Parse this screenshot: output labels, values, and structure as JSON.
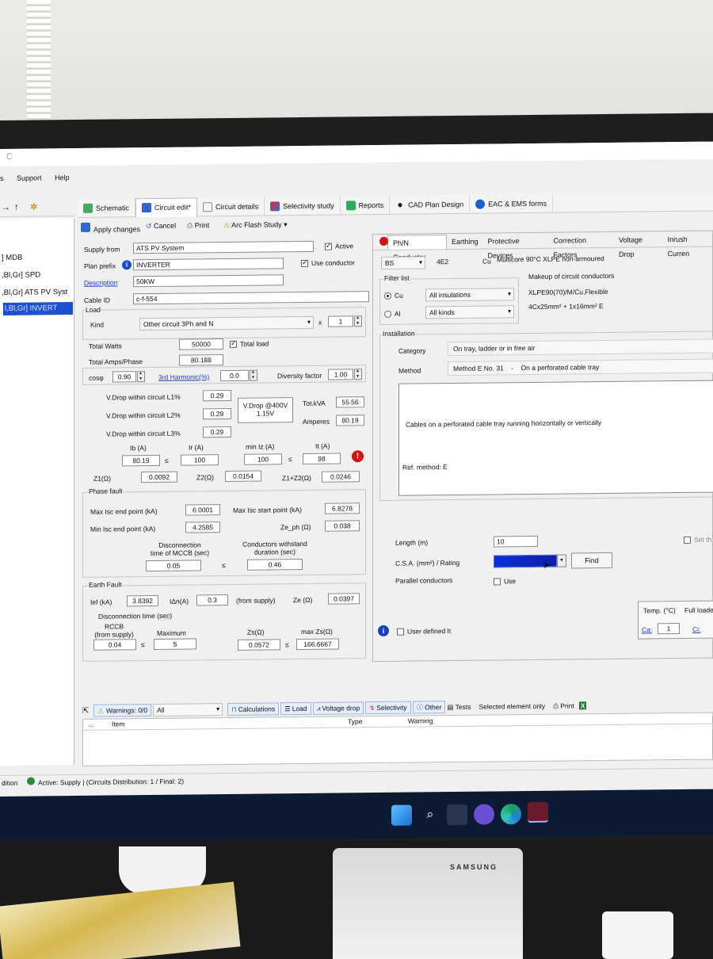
{
  "monitor": {
    "brand": "SAMSUNG"
  },
  "menu": [
    "s",
    "Support",
    "Help"
  ],
  "tabs": [
    "Schematic",
    "Circuit edit*",
    "Circuit details",
    "Selectivity study",
    "Reports",
    "CAD Plan Design",
    "EAC & EMS forms"
  ],
  "toolbar": {
    "apply": "Apply changes",
    "cancel": "Cancel",
    "print": "Print",
    "arc": "Arc Flash Study"
  },
  "tree": [
    {
      "label": "] MDB"
    },
    {
      "label": ",Bl,Gr] SPD"
    },
    {
      "label": ",Bl,Gr] ATS PV Syst"
    },
    {
      "label": "l,Bl,Gr] INVERT"
    }
  ],
  "form": {
    "supply_label": "Supply from",
    "supply": "ATS PV System",
    "active_label": "Active",
    "prefix_label": "Plan prefix",
    "prefix": "INVERTER",
    "use_conductor": "Use conductor",
    "desc_label": "Description",
    "desc": "50KW",
    "cable_label": "Cable ID",
    "cable": "c-f-554",
    "load_label": "Load",
    "kind_label": "Kind",
    "kind": "Other circuit 3Ph and N",
    "x_label": "x",
    "qty": "1",
    "watts_label": "Total Watts",
    "watts": "50000",
    "total_load": "Total load",
    "amps_label": "Total Amps/Phase",
    "amps": "80.188",
    "cosphi_label": "cosφ",
    "cosphi": "0.90",
    "harmonic_label": "3rd Harmonic(%)",
    "harmonic": "0.0",
    "diversity_label": "Diversity factor",
    "diversity": "1.00",
    "vd1_label": "V.Drop within circuit L1%",
    "vd1": "0.29",
    "vd2_label": "V.Drop within circuit L2%",
    "vd2": "0.29",
    "vd3_label": "V.Drop within circuit L3%",
    "vd3": "0.29",
    "vdrop_box": "V.Drop @400V",
    "vdrop_val": "1.15V",
    "kva_label": "Tot.kVA",
    "kva": "55.56",
    "amperes_label": "Amperes",
    "amperes": "80.19",
    "ib_label": "Ib (A)",
    "ib": "80.19",
    "ir_label": "Ir (A)",
    "ir": "100",
    "miniz_label": "min Iz (A)",
    "miniz": "100",
    "it_label": "It (A)",
    "it": "98",
    "le": "≤",
    "z1_label": "Z1(Ω)",
    "z1": "0.0092",
    "z2_label": "Z2(Ω)",
    "z2": "0.0154",
    "z12_label": "Z1+Z2(Ω)",
    "z12": "0.0246",
    "phase_label": "Phase fault",
    "maxisc_label": "Max Isc end point (kA)",
    "maxisc": "6.0001",
    "maxiscs_label": "Max Isc start point (kA)",
    "maxiscs": "6.8278",
    "miniscl_label": "Min Isc end point (kA)",
    "minisc": "4.2585",
    "zeph_label": "Ze_ph (Ω)",
    "zeph": "0.038",
    "disc_label1": "Disconnection",
    "disc_label2": "time of MCCB (sec)",
    "disc": "0.05",
    "with_label1": "Conductors withstand",
    "with_label2": "duration (sec)",
    "withstand": "0.46",
    "earth_label": "Earth Fault",
    "ief_label": "Ief (kA)",
    "ief": "3.8392",
    "idn_label": "IΔn(A)",
    "idn": "0.3",
    "from_supply": "(from supply)",
    "ze_label": "Ze (Ω)",
    "ze": "0.0397",
    "dtime_label": "Disconnection time (sec)",
    "rccb_label1": "RCCB",
    "rccb_label2": "(from supply)",
    "rccb": "0.04",
    "maximum_label": "Maximum",
    "maximum": "5",
    "zs_label": "Zs(Ω)",
    "zs": "0.0572",
    "maxzs_label": "max Zs(Ω)",
    "maxzs": "166.6667"
  },
  "right": {
    "tabs": [
      "Ph/N Conductor",
      "Earthing",
      "Protective Devices",
      "Correction Factors",
      "Voltage Drop",
      "Inrush Curren"
    ],
    "std": "BS",
    "code": "4E2",
    "mat": "Cu",
    "cable_desc": "Multicore 90°C XLPE non-armoured",
    "filter_label": "Filter list",
    "cu": "Cu",
    "al": "Al",
    "insul": "All insulations",
    "kinds": "All kinds",
    "makeup_label": "Makeup of circuit conductors",
    "makeup1": "XLPE90(70)/M/Cu,Flexible",
    "makeup2": "4Cx25mm² + 1x16mm² E",
    "install_label": "Installation",
    "category_label": "Category",
    "category": "On tray, ladder or in free air",
    "method_label": "Method",
    "method": "Method E No. 31",
    "method_sep": "-",
    "method_desc": "On a perforated cable tray",
    "desc": "Cables on a perforated cable tray running horizontally or vertically",
    "ref": "Ref. method: E",
    "length_label": "Length (m)",
    "length": "10",
    "set_label": "Set th",
    "csa_label": "C.S.A. (mm²) / Rating",
    "find": "Find",
    "parallel_label": "Parallel conductors",
    "use": "Use",
    "user_defined": "User defined It",
    "temp_label": "Temp. (°C)",
    "full_label": "Full loade",
    "ca_label": "Ca:",
    "ca": "1",
    "ci_label": "Ci:"
  },
  "bottom": {
    "warnings": "Warnings: 0/0",
    "all": "All",
    "calc": "Calculations",
    "load": "Load",
    "vdrop": "Voltage drop",
    "sel": "Selectivity",
    "other": "Other",
    "tests": "Tests",
    "selected": "Selected element only",
    "print": "Print",
    "ellipsis": "...",
    "item": "Item",
    "type": "Type",
    "warning": "Warning"
  },
  "status": {
    "left": "dition",
    "active": "Active: Supply | (Circuits Distribution: 1 / Final: 2)"
  }
}
